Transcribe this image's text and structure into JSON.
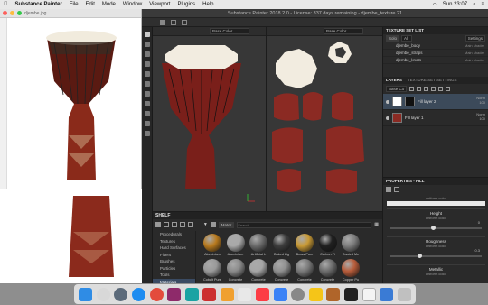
{
  "menubar": {
    "app": "Substance Painter",
    "items": [
      "File",
      "Edit",
      "Mode",
      "Window",
      "Viewport",
      "Plugins",
      "Help"
    ],
    "clock": "Sun 23:07"
  },
  "preview": {
    "title": "djembe.jpg"
  },
  "painter": {
    "title": "Substance Painter 2018.2.0 - License: 337 days remaining - djembe_texture 21",
    "viewport3d": {
      "channel": "Base Color"
    },
    "viewport2d": {
      "channel": "Base Color"
    }
  },
  "texture_set_list": {
    "title": "TEXTURE SET LIST",
    "solo": "Solo",
    "all": "All",
    "settings": "Settings",
    "items": [
      {
        "name": "djembe_body",
        "shader": "Main shader"
      },
      {
        "name": "djembe_straps",
        "shader": "Main shader"
      },
      {
        "name": "djembe_knots",
        "shader": "Main shader"
      }
    ]
  },
  "layers": {
    "tab_layers": "LAYERS",
    "tab_settings": "TEXTURE SET SETTINGS",
    "channel": "Base Co",
    "items": [
      {
        "name": "Fill layer 2",
        "blend": "Norm",
        "opacity": "100"
      },
      {
        "name": "Fill layer 1",
        "blend": "Norm",
        "opacity": "100"
      }
    ]
  },
  "properties": {
    "title": "PROPERTIES - FILL",
    "uniform_color": "uniform color",
    "height": {
      "label": "Height",
      "sub": "uniform color",
      "value": "0"
    },
    "roughness": {
      "label": "Roughness",
      "sub": "uniform color",
      "value": "0.3"
    },
    "metallic": {
      "label": "Metallic",
      "sub": "uniform color"
    }
  },
  "shelf": {
    "title": "SHELF",
    "filter": "Mater",
    "search_placeholder": "Search...",
    "categories": [
      "Procedurals",
      "Textures",
      "Hard Surfaces",
      "Filters",
      "Brushes",
      "Particles",
      "Tools",
      "Materials"
    ],
    "selected_category": "Materials",
    "materials": [
      {
        "name": "Aluminium",
        "color": "#b87a1e"
      },
      {
        "name": "Aluminium",
        "color": "#a9a9a9"
      },
      {
        "name": "Artificial L",
        "color": "#6b6b6b"
      },
      {
        "name": "Baked Lig",
        "color": "#3d3d3d"
      },
      {
        "name": "Brass Pure",
        "color": "#c99a35"
      },
      {
        "name": "Carbon Fi",
        "color": "#202020"
      },
      {
        "name": "Coated Me",
        "color": "#7e7e7e"
      },
      {
        "name": "Cobalt Pure",
        "color": "#9a9a9a"
      },
      {
        "name": "Concrete",
        "color": "#8b8b8b"
      },
      {
        "name": "Concrete",
        "color": "#a6a6a6"
      },
      {
        "name": "Concrete",
        "color": "#909090"
      },
      {
        "name": "Concrete",
        "color": "#7a7a7a"
      },
      {
        "name": "Concrete",
        "color": "#6e6e6e"
      },
      {
        "name": "Copper Pu",
        "color": "#b85c3a"
      }
    ]
  },
  "colors": {
    "drum_red": "#7a1f1a",
    "drum_cream": "#f2ece0",
    "uv_red": "#8b2a23"
  }
}
